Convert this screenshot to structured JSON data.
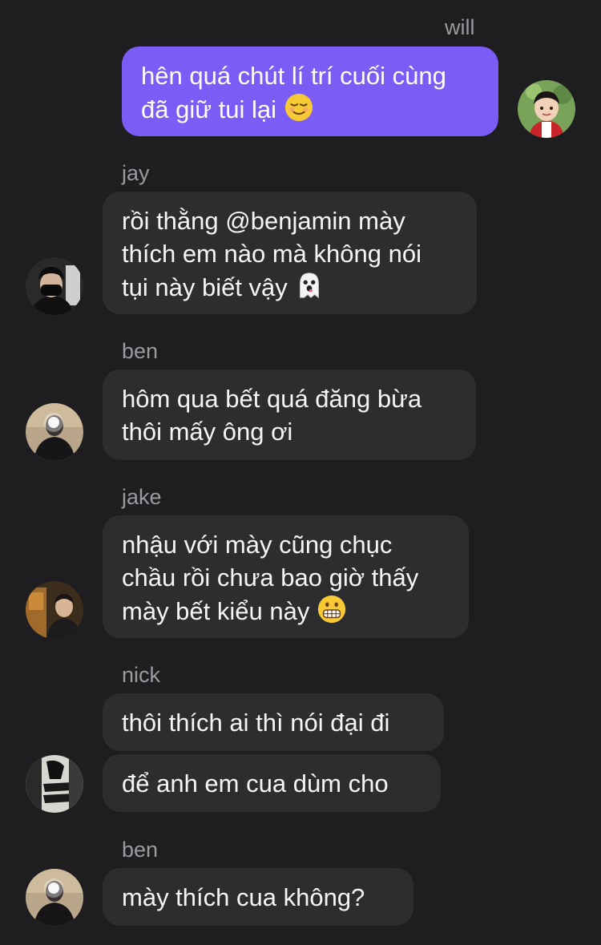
{
  "chat": {
    "messages": [
      {
        "sender": "will",
        "lines": [
          "hên quá chút lí trí cuối cùng",
          "đã giữ tui lại"
        ],
        "emoji": "relieved-face-emoji"
      },
      {
        "sender": "jay",
        "lines": [
          "rồi thằng @benjamin mày",
          "thích em nào mà không nói",
          "tụi này biết vậy"
        ],
        "emoji": "ghost-emoji"
      },
      {
        "sender": "ben",
        "lines": [
          "hôm qua bết quá đăng bừa",
          "thôi mấy ông ơi"
        ]
      },
      {
        "sender": "jake",
        "lines": [
          "nhậu với mày cũng chục",
          "chầu rồi chưa bao giờ thấy",
          "mày bết kiểu này"
        ],
        "emoji": "grimacing-face-emoji"
      },
      {
        "sender": "nick",
        "lines": [
          "thôi thích ai thì nói đại đi"
        ]
      },
      {
        "sender": "",
        "lines": [
          "để anh em cua dùm cho"
        ]
      },
      {
        "sender": "ben",
        "lines": [
          "mày thích cua không?"
        ]
      }
    ]
  },
  "colors": {
    "background": "#1e1e20",
    "received_bubble": "#2d2d30",
    "sent_bubble": "#7b5cf4",
    "sender_name": "#9a9a9f"
  }
}
